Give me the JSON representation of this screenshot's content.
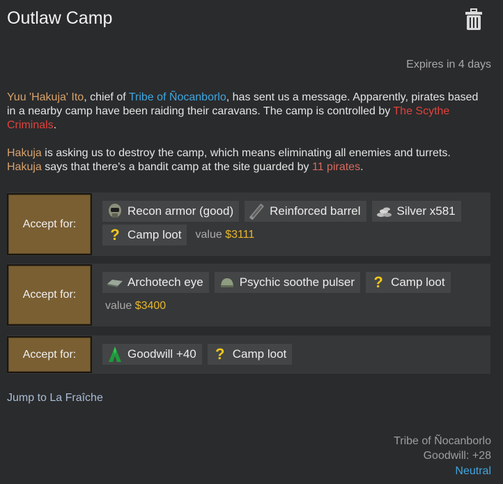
{
  "header": {
    "title": "Outlaw Camp",
    "expires": "Expires in 4 days"
  },
  "message": {
    "p1": {
      "asker": "Yuu 'Hakuja' Ito",
      "t1": ", chief of ",
      "faction": "Tribe of Ñocanborlo",
      "t2": ", has sent us a message. Apparently, pirates based in a nearby camp have been raiding their caravans. The camp is controlled by ",
      "enemy": "The Scythe Criminals",
      "t3": "."
    },
    "p2": {
      "name1": "Hakuja",
      "t1": " is asking us to destroy the camp, which means eliminating all enemies and turrets. ",
      "name2": "Hakuja",
      "t2": " says that there's a bandit camp at the site guarded by ",
      "count": "11 pirates",
      "t3": "."
    }
  },
  "rewards": {
    "accept_label": "Accept for:",
    "value_label": "value",
    "option1": {
      "items": [
        "Recon armor (good)",
        "Reinforced barrel",
        "Silver x581",
        "Camp loot"
      ],
      "value": "$3111"
    },
    "option2": {
      "items": [
        "Archotech eye",
        "Psychic soothe pulser",
        "Camp loot"
      ],
      "value": "$3400"
    },
    "option3": {
      "items": [
        "Goodwill +40",
        "Camp loot"
      ]
    }
  },
  "jump_link": "Jump to La Fraîche",
  "footer": {
    "faction": "Tribe of Ñocanborlo",
    "goodwill": "Goodwill: +28",
    "relation": "Neutral"
  },
  "colors": {
    "background": "#2a2b2d",
    "faction": "#3fa6e0",
    "enemy": "#e0423b",
    "person": "#d8a26b",
    "money": "#e7b72b",
    "accept_button": "#7a5f33"
  },
  "icons": [
    "trash-icon",
    "recon-armor-icon",
    "barrel-icon",
    "silver-icon",
    "question-icon",
    "archotech-eye-icon",
    "psychic-pulser-icon",
    "goodwill-icon"
  ]
}
